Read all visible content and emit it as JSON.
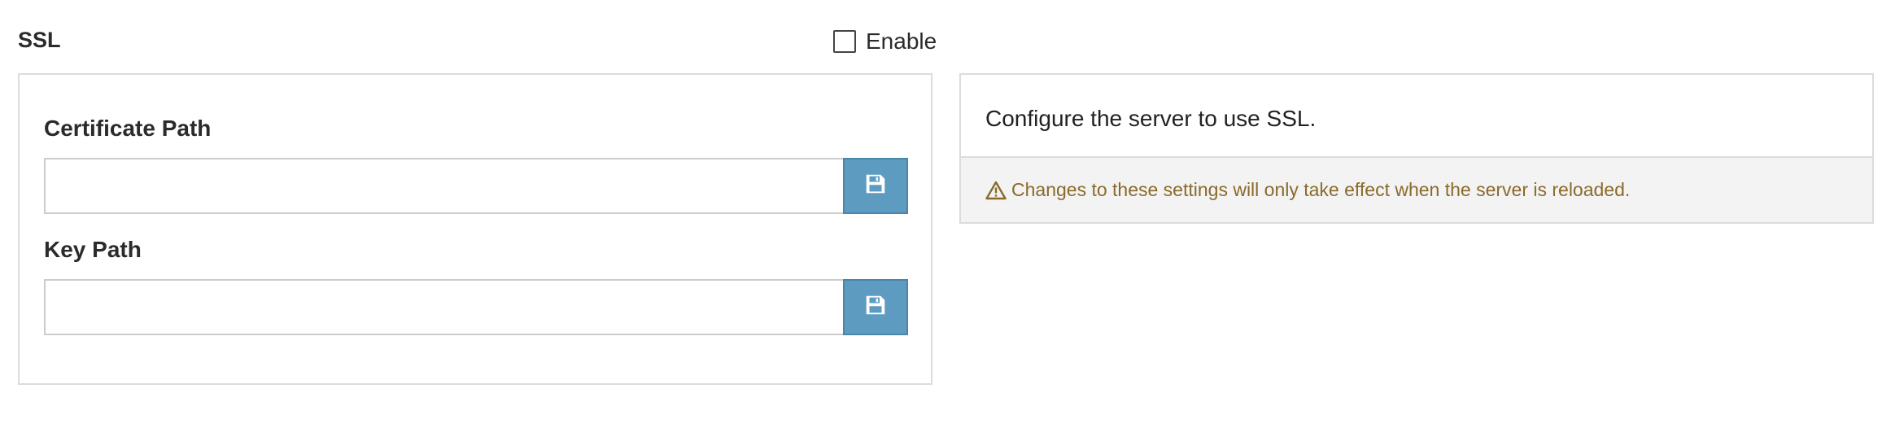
{
  "section": {
    "title": "SSL",
    "enable_label": "Enable",
    "enable_checked": false
  },
  "fields": {
    "certificate": {
      "label": "Certificate Path",
      "value": "",
      "icon": "save-icon"
    },
    "key": {
      "label": "Key Path",
      "value": "",
      "icon": "save-icon"
    }
  },
  "info": {
    "description": "Configure the server to use SSL.",
    "warning": "Changes to these settings will only take effect when the server is reloaded.",
    "warning_icon": "warning-icon"
  },
  "colors": {
    "save_button": "#5d9cc0",
    "warning_text": "#8a6a2a",
    "warning_bg": "#f3f3f3",
    "border": "#dcdcdc"
  }
}
